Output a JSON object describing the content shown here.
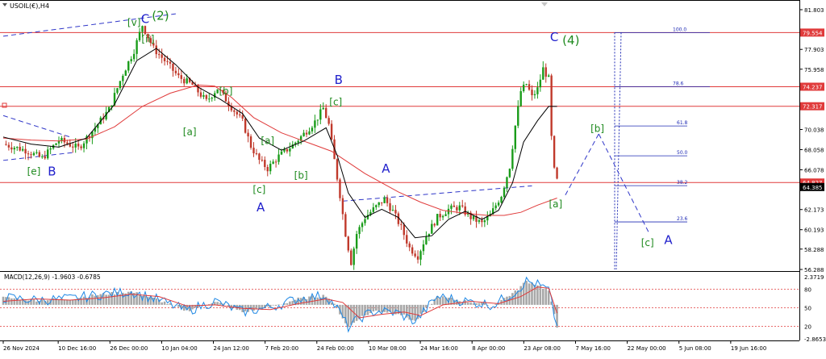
{
  "window": {
    "symbol_title": "USOIL(€),H4"
  },
  "colors": {
    "candle_up": "#1a9c1a",
    "candle_down": "#c0392b",
    "ema_fast": "#000000",
    "ema_slow": "#e03b3b",
    "hline": "#e03b3b",
    "trendline": "#2f36c8",
    "fib": "#1f2bb5",
    "wave_blue": "#2020cc",
    "wave_green": "#1f8a1f",
    "macd_hist": "#a8a8a8",
    "macd_line": "#1e88e5",
    "macd_signal": "#e03b3b",
    "price_tag_bg": "#e03b3b"
  },
  "chart_data": [
    {
      "type": "candlestick",
      "title": "USOIL(€),H4",
      "ylim": [
        56.288,
        81.803
      ],
      "y_ticks": [
        "81.803",
        "79.554",
        "77.903",
        "75.958",
        "74.237",
        "72.317",
        "70.038",
        "68.058",
        "66.078",
        "64.827",
        "64.385",
        "62.173",
        "60.193",
        "58.288",
        "56.288"
      ],
      "x_ticks": [
        "26 Nov 2024",
        "10 Dec 16:00",
        "26 Dec 00:00",
        "10 Jan 04:00",
        "24 Jan 12:00",
        "7 Feb 20:00",
        "24 Feb 00:00",
        "10 Mar 08:00",
        "24 Mar 16:00",
        "8 Apr 00:00",
        "23 Apr 08:00",
        "7 May 16:00",
        "22 May 00:00",
        "5 Jun 08:00",
        "19 Jun 16:00"
      ],
      "price_tags": [
        {
          "value": 79.554,
          "label": "79.554"
        },
        {
          "value": 74.237,
          "label": "74.237"
        },
        {
          "value": 72.317,
          "label": "72.317"
        },
        {
          "value": 64.827,
          "label": "64.827"
        },
        {
          "value": 64.385,
          "label": "64.385",
          "dark": true
        }
      ],
      "horizontal_levels": [
        79.554,
        74.237,
        72.317,
        64.827
      ],
      "price_path": [
        [
          0,
          68.6
        ],
        [
          8,
          68.0
        ],
        [
          14,
          67.2
        ],
        [
          20,
          69.0
        ],
        [
          27,
          68.2
        ],
        [
          33,
          70.2
        ],
        [
          38,
          72.0
        ],
        [
          43,
          75.5
        ],
        [
          47,
          77.8
        ],
        [
          50,
          80.3
        ],
        [
          54,
          78.0
        ],
        [
          58,
          76.8
        ],
        [
          63,
          75.2
        ],
        [
          68,
          74.4
        ],
        [
          73,
          72.8
        ],
        [
          77,
          74.1
        ],
        [
          81,
          72.6
        ],
        [
          86,
          70.8
        ],
        [
          89,
          68.4
        ],
        [
          92,
          67.0
        ],
        [
          95,
          66.2
        ],
        [
          99,
          67.4
        ],
        [
          104,
          68.5
        ],
        [
          108,
          69.6
        ],
        [
          112,
          70.8
        ],
        [
          115,
          72.1
        ],
        [
          117,
          70.5
        ],
        [
          119,
          67.0
        ],
        [
          121,
          63.6
        ],
        [
          123,
          59.8
        ],
        [
          125,
          57.0
        ],
        [
          127,
          59.8
        ],
        [
          130,
          61.4
        ],
        [
          133,
          62.2
        ],
        [
          137,
          63.2
        ],
        [
          140,
          62.0
        ],
        [
          143,
          60.4
        ],
        [
          146,
          58.4
        ],
        [
          149,
          57.6
        ],
        [
          152,
          59.6
        ],
        [
          156,
          61.4
        ],
        [
          160,
          62.2
        ],
        [
          164,
          62.4
        ],
        [
          168,
          61.4
        ],
        [
          172,
          60.8
        ],
        [
          175,
          61.6
        ],
        [
          179,
          63.6
        ],
        [
          182,
          66.4
        ],
        [
          184,
          70.4
        ],
        [
          186,
          73.8
        ],
        [
          188,
          74.5
        ],
        [
          190,
          73.2
        ],
        [
          192,
          74.0
        ],
        [
          194,
          76.0
        ],
        [
          196,
          75.0
        ],
        [
          197,
          69.2
        ],
        [
          198,
          66.0
        ],
        [
          199,
          65.0
        ]
      ],
      "ema_fast_path": [
        [
          0,
          69.3
        ],
        [
          10,
          68.6
        ],
        [
          20,
          68.3
        ],
        [
          30,
          69.2
        ],
        [
          40,
          72.5
        ],
        [
          48,
          76.8
        ],
        [
          55,
          78.0
        ],
        [
          62,
          76.4
        ],
        [
          70,
          74.2
        ],
        [
          78,
          73.0
        ],
        [
          86,
          71.6
        ],
        [
          92,
          69.2
        ],
        [
          100,
          68.0
        ],
        [
          108,
          68.9
        ],
        [
          116,
          70.2
        ],
        [
          120,
          67.5
        ],
        [
          124,
          63.8
        ],
        [
          130,
          61.4
        ],
        [
          136,
          62.2
        ],
        [
          142,
          61.4
        ],
        [
          148,
          59.4
        ],
        [
          154,
          59.6
        ],
        [
          160,
          61.2
        ],
        [
          166,
          62.0
        ],
        [
          172,
          61.2
        ],
        [
          178,
          62.1
        ],
        [
          183,
          64.8
        ],
        [
          187,
          68.8
        ],
        [
          192,
          70.9
        ],
        [
          196,
          72.3
        ],
        [
          199,
          72.3
        ]
      ],
      "ema_slow_path": [
        [
          0,
          69.2
        ],
        [
          10,
          69.0
        ],
        [
          20,
          68.9
        ],
        [
          30,
          69.1
        ],
        [
          40,
          70.3
        ],
        [
          50,
          72.3
        ],
        [
          60,
          73.6
        ],
        [
          70,
          74.4
        ],
        [
          76,
          74.3
        ],
        [
          82,
          73.2
        ],
        [
          90,
          71.2
        ],
        [
          100,
          69.7
        ],
        [
          110,
          68.7
        ],
        [
          118,
          67.9
        ],
        [
          124,
          66.8
        ],
        [
          130,
          65.7
        ],
        [
          136,
          64.8
        ],
        [
          142,
          63.9
        ],
        [
          150,
          62.9
        ],
        [
          158,
          62.1
        ],
        [
          166,
          61.8
        ],
        [
          174,
          61.6
        ],
        [
          180,
          61.6
        ],
        [
          186,
          61.9
        ],
        [
          192,
          62.6
        ],
        [
          199,
          63.3
        ]
      ],
      "trendlines": [
        {
          "from": [
            0,
            79.2
          ],
          "to": [
            62,
            81.4
          ]
        },
        {
          "from": [
            0,
            71.4
          ],
          "to": [
            24,
            69.3
          ]
        },
        {
          "from": [
            0,
            67.0
          ],
          "to": [
            26,
            67.8
          ]
        },
        {
          "from": [
            122,
            63.0
          ],
          "to": [
            190,
            64.5
          ]
        },
        {
          "from": [
            202,
            63.6
          ],
          "to": [
            214,
            69.6
          ]
        },
        {
          "from": [
            214,
            69.6
          ],
          "to": [
            232,
            59.9
          ]
        }
      ],
      "fibonacci": {
        "levels": [
          {
            "label": "100.0",
            "value": 79.554
          },
          {
            "label": "78.6",
            "value": 74.237
          },
          {
            "label": "61.8",
            "value": 70.38
          },
          {
            "label": "50.0",
            "value": 67.45
          },
          {
            "label": "38.2",
            "value": 64.52
          },
          {
            "label": "23.6",
            "value": 60.96
          }
        ]
      },
      "wave_labels": [
        {
          "text": "[v]",
          "x": 47,
          "y": 80.2,
          "color": "green",
          "size": 12
        },
        {
          "text": "C",
          "x": 51,
          "y": 80.5,
          "color": "blue",
          "size": 15
        },
        {
          "text": "(2)",
          "x": 56.5,
          "y": 80.8,
          "color": "green",
          "size": 15
        },
        {
          "text": "[ii]",
          "x": 52,
          "y": 78.6,
          "color": "green",
          "size": 12
        },
        {
          "text": "[a]",
          "x": 67,
          "y": 69.5,
          "color": "green",
          "size": 12
        },
        {
          "text": "[b]",
          "x": 80,
          "y": 73.5,
          "color": "green",
          "size": 12
        },
        {
          "text": "[e]",
          "x": 11,
          "y": 65.6,
          "color": "green",
          "size": 12
        },
        {
          "text": "B",
          "x": 17.5,
          "y": 65.5,
          "color": "blue",
          "size": 15
        },
        {
          "text": "[a]",
          "x": 95,
          "y": 68.6,
          "color": "green",
          "size": 12
        },
        {
          "text": "[b]",
          "x": 107,
          "y": 65.2,
          "color": "green",
          "size": 12
        },
        {
          "text": "[c]",
          "x": 92,
          "y": 63.8,
          "color": "green",
          "size": 12
        },
        {
          "text": "A",
          "x": 92.5,
          "y": 62.0,
          "color": "blue",
          "size": 15
        },
        {
          "text": "B",
          "x": 120.5,
          "y": 74.5,
          "color": "blue",
          "size": 15
        },
        {
          "text": "[c]",
          "x": 119.5,
          "y": 72.4,
          "color": "green",
          "size": 12
        },
        {
          "text": "A",
          "x": 137.5,
          "y": 65.8,
          "color": "blue",
          "size": 15
        },
        {
          "text": "C",
          "x": 198,
          "y": 78.7,
          "color": "blue",
          "size": 15
        },
        {
          "text": "(4)",
          "x": 204,
          "y": 78.4,
          "color": "green",
          "size": 15
        },
        {
          "text": "[a]",
          "x": 198.5,
          "y": 62.4,
          "color": "green",
          "size": 12
        },
        {
          "text": "[b]",
          "x": 213.5,
          "y": 69.8,
          "color": "green",
          "size": 12
        },
        {
          "text": "[c]",
          "x": 231.5,
          "y": 58.6,
          "color": "green",
          "size": 12
        },
        {
          "text": "A",
          "x": 239,
          "y": 58.8,
          "color": "blue",
          "size": 15
        }
      ]
    },
    {
      "type": "macd",
      "title": "MACD(12,26,9) -1.9603 -0.6785",
      "params": "12,26,9",
      "values": {
        "macd": -1.9603,
        "signal": -0.6785
      },
      "ylim": [
        -2.8653,
        2.3719
      ],
      "y_ticks": [
        "2.3719",
        "80",
        "50",
        "20",
        "-2.8653"
      ],
      "dotted_levels": [
        80,
        50,
        20
      ],
      "bar_path": [
        [
          0,
          0.6
        ],
        [
          12,
          0.4
        ],
        [
          24,
          0.5
        ],
        [
          36,
          0.9
        ],
        [
          46,
          1.1
        ],
        [
          56,
          0.4
        ],
        [
          66,
          -0.5
        ],
        [
          76,
          0.3
        ],
        [
          86,
          -0.6
        ],
        [
          96,
          -0.2
        ],
        [
          106,
          0.5
        ],
        [
          116,
          0.8
        ],
        [
          120,
          -0.3
        ],
        [
          124,
          -1.9
        ],
        [
          128,
          -1.1
        ],
        [
          134,
          -0.5
        ],
        [
          142,
          -0.7
        ],
        [
          148,
          -1.4
        ],
        [
          156,
          0.7
        ],
        [
          166,
          0.3
        ],
        [
          176,
          0.0
        ],
        [
          184,
          1.1
        ],
        [
          188,
          2.0
        ],
        [
          192,
          1.7
        ],
        [
          196,
          1.2
        ],
        [
          199,
          -1.9
        ]
      ],
      "signal_path": [
        [
          0,
          0.3
        ],
        [
          12,
          0.5
        ],
        [
          24,
          0.4
        ],
        [
          36,
          0.6
        ],
        [
          46,
          0.9
        ],
        [
          56,
          0.7
        ],
        [
          66,
          -0.1
        ],
        [
          76,
          0.0
        ],
        [
          86,
          -0.3
        ],
        [
          96,
          -0.4
        ],
        [
          106,
          0.1
        ],
        [
          116,
          0.5
        ],
        [
          122,
          0.2
        ],
        [
          128,
          -1.1
        ],
        [
          136,
          -0.8
        ],
        [
          144,
          -0.6
        ],
        [
          150,
          -0.9
        ],
        [
          158,
          0.0
        ],
        [
          168,
          0.3
        ],
        [
          178,
          0.1
        ],
        [
          186,
          0.7
        ],
        [
          192,
          1.5
        ],
        [
          196,
          1.4
        ],
        [
          199,
          -0.7
        ]
      ]
    }
  ]
}
